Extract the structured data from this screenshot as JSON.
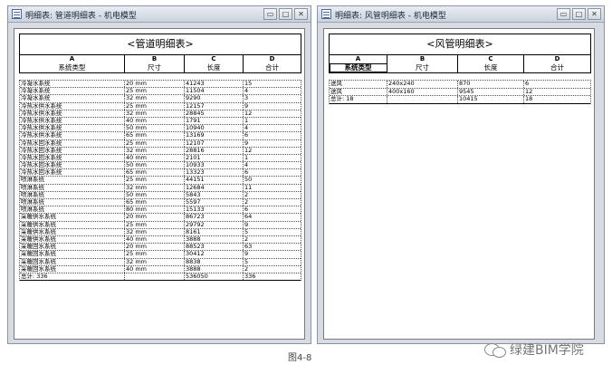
{
  "left_window": {
    "title": "明细表: 管道明细表 - 机电模型",
    "schedule_title": "<管道明细表>",
    "columns": [
      {
        "letter": "A",
        "header": "系统类型"
      },
      {
        "letter": "B",
        "header": "尺寸"
      },
      {
        "letter": "C",
        "header": "长度"
      },
      {
        "letter": "D",
        "header": "合计"
      }
    ],
    "rows": [
      [
        "冷凝水系统",
        "20 mm",
        "41243",
        "15"
      ],
      [
        "冷凝水系统",
        "25 mm",
        "11504",
        "4"
      ],
      [
        "冷凝水系统",
        "32 mm",
        "9290",
        "3"
      ],
      [
        "冷热水供水系统",
        "25 mm",
        "12157",
        "9"
      ],
      [
        "冷热水供水系统",
        "32 mm",
        "28845",
        "12"
      ],
      [
        "冷热水供水系统",
        "40 mm",
        "1791",
        "1"
      ],
      [
        "冷热水供水系统",
        "50 mm",
        "10940",
        "4"
      ],
      [
        "冷热水供水系统",
        "65 mm",
        "13169",
        "6"
      ],
      [
        "冷热水回水系统",
        "25 mm",
        "12107",
        "9"
      ],
      [
        "冷热水回水系统",
        "32 mm",
        "28816",
        "12"
      ],
      [
        "冷热水回水系统",
        "40 mm",
        "2101",
        "1"
      ],
      [
        "冷热水回水系统",
        "50 mm",
        "10933",
        "4"
      ],
      [
        "冷热水回水系统",
        "65 mm",
        "13323",
        "6"
      ],
      [
        "喷淋系统",
        "25 mm",
        "44151",
        "50"
      ],
      [
        "喷淋系统",
        "32 mm",
        "12684",
        "11"
      ],
      [
        "喷淋系统",
        "50 mm",
        "5843",
        "2"
      ],
      [
        "喷淋系统",
        "65 mm",
        "5597",
        "2"
      ],
      [
        "喷淋系统",
        "80 mm",
        "15133",
        "6"
      ],
      [
        "采暖供水系统",
        "20 mm",
        "86723",
        "64"
      ],
      [
        "采暖供水系统",
        "25 mm",
        "29792",
        "9"
      ],
      [
        "采暖供水系统",
        "32 mm",
        "8161",
        "5"
      ],
      [
        "采暖供水系统",
        "40 mm",
        "3888",
        "2"
      ],
      [
        "采暖回水系统",
        "20 mm",
        "88523",
        "63"
      ],
      [
        "采暖回水系统",
        "25 mm",
        "30412",
        "9"
      ],
      [
        "采暖回水系统",
        "32 mm",
        "8838",
        "5"
      ],
      [
        "采暖回水系统",
        "40 mm",
        "3888",
        "2"
      ]
    ],
    "total": [
      "总计: 336",
      "",
      "536050",
      "336"
    ]
  },
  "right_window": {
    "title": "明细表: 风管明细表 - 机电模型",
    "schedule_title": "<风管明细表>",
    "columns": [
      {
        "letter": "A",
        "header": "系统类型"
      },
      {
        "letter": "B",
        "header": "尺寸"
      },
      {
        "letter": "C",
        "header": "长度"
      },
      {
        "letter": "D",
        "header": "合计"
      }
    ],
    "rows": [
      [
        "送风",
        "240x240",
        "870",
        "6"
      ],
      [
        "送风",
        "400x160",
        "9545",
        "12"
      ]
    ],
    "total": [
      "总计: 18",
      "",
      "10415",
      "18"
    ]
  },
  "caption": "图4-8",
  "watermark": "绿建BIM学院",
  "window_controls": {
    "minimize": "▭",
    "maximize": "□",
    "close": "✕"
  }
}
